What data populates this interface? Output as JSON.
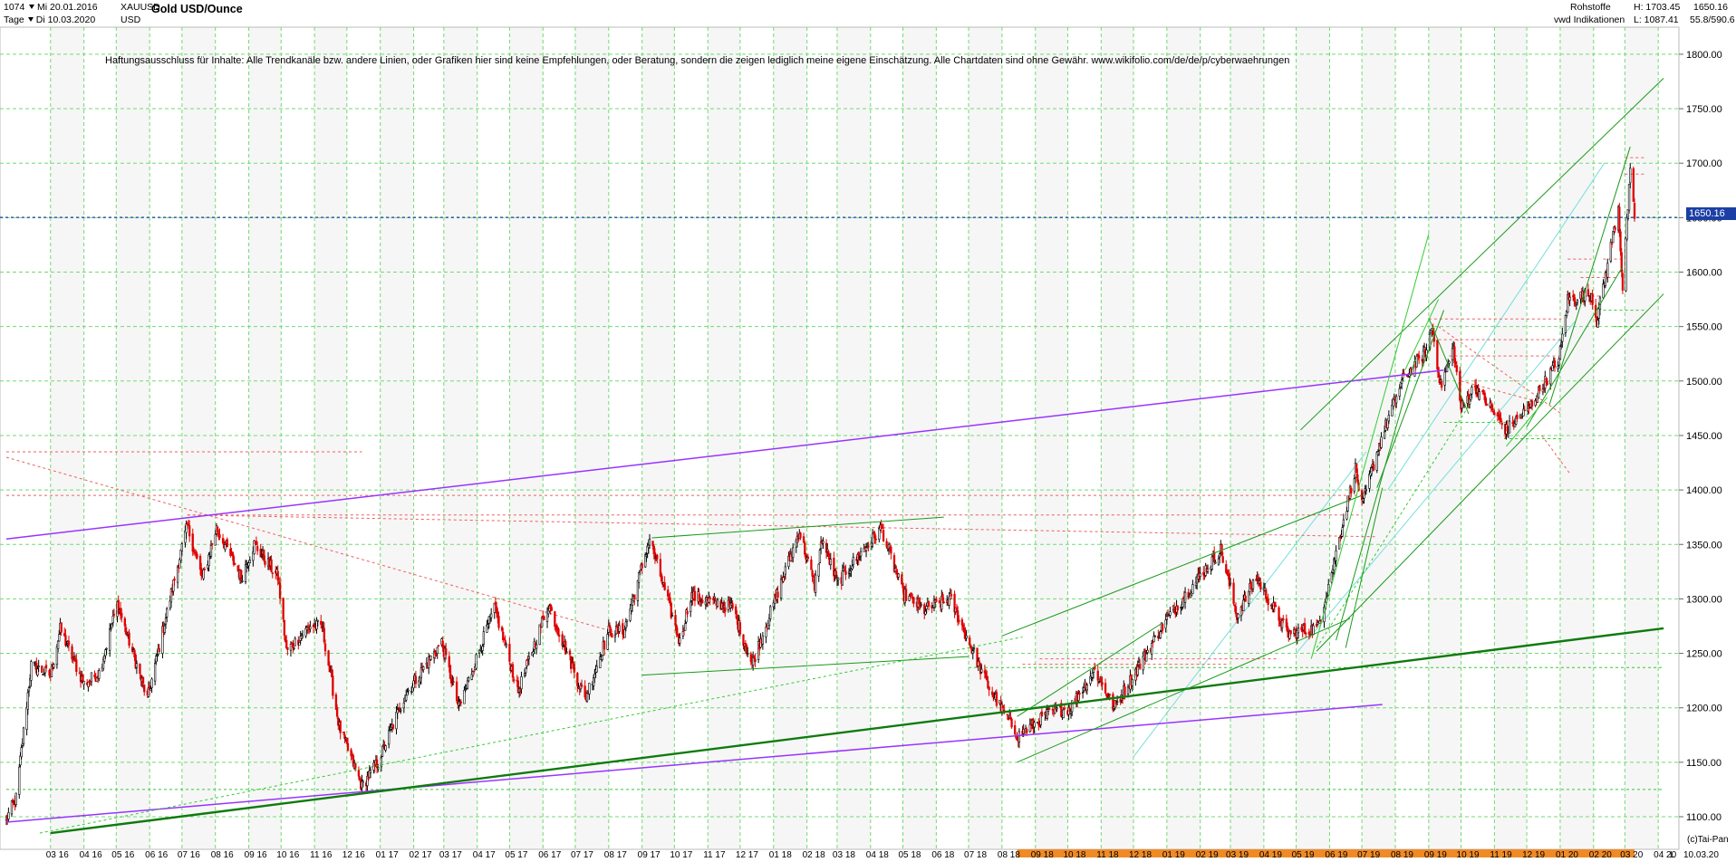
{
  "header": {
    "count": "1074",
    "start_label": "Mi 20.01.2016",
    "symbol": "XAUUSD",
    "currency": "USD",
    "interval": "Tage",
    "end_label": "Di 10.03.2020",
    "title": "Gold USD/Ounce",
    "category": "Rohstoffe",
    "source": "vwd Indikationen",
    "high_text": "H: 1703.45",
    "low_text": "L: 1087.41",
    "last_value": "1650.16",
    "last_change": "55.8/590.6"
  },
  "disclaimer": "Haftungsausschluss für Inhalte: Alle Trendkanäle bzw. andere Linien, oder Grafiken hier sind keine Empfehlungen, oder Beratung, sondern die zeigen lediglich meine eigene Einschätzung. Alle Chartdaten sind ohne Gewähr.  www.wikifolio.com/de/de/p/cyberwaehrungen",
  "copyright": "(c)Tai-Pan",
  "current_price_label": "1650.16",
  "colors": {
    "up_candle": "#000000",
    "down_candle": "#e00000",
    "grid": "#74d974",
    "current_line": "#1b3fa5",
    "axis_orange": "#f08a24",
    "purple_trend": "#9933ff",
    "green_trend": "#1a9a1a",
    "light_green": "#33cc33",
    "red_dotted": "#ee6060",
    "cyan": "#77dddd"
  },
  "chart_data": {
    "type": "candlestick",
    "title": "Gold USD/Ounce",
    "ylim": [
      1100,
      1800
    ],
    "y_ticks": [
      1100,
      1150,
      1200,
      1250,
      1300,
      1350,
      1400,
      1450,
      1500,
      1550,
      1600,
      1650,
      1700,
      1750,
      1800
    ],
    "y_tick_labels": [
      "1100.00",
      "1150.00",
      "1200.00",
      "1250.00",
      "1300.00",
      "1350.00",
      "1400.00",
      "1450.00",
      "1500.00",
      "1550.00",
      "1600.00",
      "1650.00",
      "1700.00",
      "1750.00",
      "1800.00"
    ],
    "x_tick_labels": [
      "03 16",
      "04 16",
      "05 16",
      "06 16",
      "07 16",
      "08 16",
      "09 16",
      "10 16",
      "11 16",
      "12 16",
      "01 17",
      "02 17",
      "03 17",
      "04 17",
      "05 17",
      "06 17",
      "07 17",
      "08 17",
      "09 17",
      "10 17",
      "11 17",
      "12 17",
      "01 18",
      "02 18",
      "03 18",
      "04 18",
      "05 18",
      "06 18",
      "07 18",
      "08 18",
      "09 18",
      "10 18",
      "11 18",
      "12 18",
      "01 19",
      "02 19",
      "03 19",
      "04 19",
      "05 19",
      "06 19",
      "07 19",
      "08 19",
      "09 19",
      "10 19",
      "11 19",
      "12 19",
      "01 20",
      "02 20",
      "03 20",
      "04 20"
    ],
    "x_end_label": "10.03.20",
    "x_axis_suffix": "L",
    "current_price": 1650.16,
    "high": 1703.45,
    "low": 1087.41,
    "monthly_anchors": [
      {
        "d": "2016-01-20",
        "c": 1098
      },
      {
        "d": "2016-01-29",
        "c": 1117
      },
      {
        "d": "2016-02-12",
        "c": 1239
      },
      {
        "d": "2016-03-01",
        "c": 1230
      },
      {
        "d": "2016-03-10",
        "c": 1272
      },
      {
        "d": "2016-04-01",
        "c": 1222
      },
      {
        "d": "2016-04-15",
        "c": 1232
      },
      {
        "d": "2016-05-02",
        "c": 1295
      },
      {
        "d": "2016-05-30",
        "c": 1208
      },
      {
        "d": "2016-06-24",
        "c": 1318
      },
      {
        "d": "2016-07-06",
        "c": 1367
      },
      {
        "d": "2016-07-20",
        "c": 1318
      },
      {
        "d": "2016-08-02",
        "c": 1365
      },
      {
        "d": "2016-08-25",
        "c": 1320
      },
      {
        "d": "2016-09-06",
        "c": 1350
      },
      {
        "d": "2016-09-28",
        "c": 1320
      },
      {
        "d": "2016-10-06",
        "c": 1252
      },
      {
        "d": "2016-10-28",
        "c": 1275
      },
      {
        "d": "2016-11-08",
        "c": 1275
      },
      {
        "d": "2016-11-24",
        "c": 1182
      },
      {
        "d": "2016-12-15",
        "c": 1128
      },
      {
        "d": "2016-12-30",
        "c": 1150
      },
      {
        "d": "2017-01-24",
        "c": 1212
      },
      {
        "d": "2017-02-27",
        "c": 1260
      },
      {
        "d": "2017-03-15",
        "c": 1200
      },
      {
        "d": "2017-04-17",
        "c": 1292
      },
      {
        "d": "2017-05-09",
        "c": 1215
      },
      {
        "d": "2017-06-06",
        "c": 1295
      },
      {
        "d": "2017-07-10",
        "c": 1208
      },
      {
        "d": "2017-08-01",
        "c": 1270
      },
      {
        "d": "2017-08-15",
        "c": 1270
      },
      {
        "d": "2017-09-08",
        "c": 1355
      },
      {
        "d": "2017-10-06",
        "c": 1260
      },
      {
        "d": "2017-10-16",
        "c": 1303
      },
      {
        "d": "2017-11-24",
        "c": 1292
      },
      {
        "d": "2017-12-12",
        "c": 1240
      },
      {
        "d": "2018-01-25",
        "c": 1362
      },
      {
        "d": "2018-02-08",
        "c": 1312
      },
      {
        "d": "2018-02-15",
        "c": 1355
      },
      {
        "d": "2018-03-01",
        "c": 1315
      },
      {
        "d": "2018-04-11",
        "c": 1365
      },
      {
        "d": "2018-05-01",
        "c": 1305
      },
      {
        "d": "2018-05-21",
        "c": 1290
      },
      {
        "d": "2018-06-14",
        "c": 1300
      },
      {
        "d": "2018-07-19",
        "c": 1220
      },
      {
        "d": "2018-08-16",
        "c": 1174
      },
      {
        "d": "2018-09-14",
        "c": 1195
      },
      {
        "d": "2018-10-03",
        "c": 1200
      },
      {
        "d": "2018-10-26",
        "c": 1235
      },
      {
        "d": "2018-11-13",
        "c": 1200
      },
      {
        "d": "2018-12-31",
        "c": 1280
      },
      {
        "d": "2019-01-31",
        "c": 1320
      },
      {
        "d": "2019-02-20",
        "c": 1345
      },
      {
        "d": "2019-03-07",
        "c": 1285
      },
      {
        "d": "2019-03-25",
        "c": 1320
      },
      {
        "d": "2019-04-23",
        "c": 1268
      },
      {
        "d": "2019-05-21",
        "c": 1273
      },
      {
        "d": "2019-06-03",
        "c": 1325
      },
      {
        "d": "2019-06-25",
        "c": 1420
      },
      {
        "d": "2019-07-01",
        "c": 1385
      },
      {
        "d": "2019-07-18",
        "c": 1445
      },
      {
        "d": "2019-08-07",
        "c": 1500
      },
      {
        "d": "2019-08-30",
        "c": 1528
      },
      {
        "d": "2019-09-04",
        "c": 1550
      },
      {
        "d": "2019-09-12",
        "c": 1495
      },
      {
        "d": "2019-09-24",
        "c": 1530
      },
      {
        "d": "2019-10-01",
        "c": 1475
      },
      {
        "d": "2019-10-14",
        "c": 1495
      },
      {
        "d": "2019-11-12",
        "c": 1455
      },
      {
        "d": "2019-12-03",
        "c": 1475
      },
      {
        "d": "2019-12-31",
        "c": 1520
      },
      {
        "d": "2020-01-08",
        "c": 1575
      },
      {
        "d": "2020-01-30",
        "c": 1580
      },
      {
        "d": "2020-02-04",
        "c": 1555
      },
      {
        "d": "2020-02-24",
        "c": 1660
      },
      {
        "d": "2020-02-28",
        "c": 1585
      },
      {
        "d": "2020-03-06",
        "c": 1690
      },
      {
        "d": "2020-03-10",
        "c": 1650
      }
    ],
    "trendlines": [
      {
        "kind": "purple",
        "from": [
          "2016-01-20",
          1355
        ],
        "to": [
          "2019-09-15",
          1510
        ]
      },
      {
        "kind": "purple",
        "from": [
          "2016-01-20",
          1095
        ],
        "to": [
          "2019-07-20",
          1203
        ]
      },
      {
        "kind": "green_thick",
        "from": [
          "2016-03-01",
          1085
        ],
        "to": [
          "2020-04-06",
          1273
        ]
      },
      {
        "kind": "green",
        "from": [
          "2018-08-15",
          1150
        ],
        "to": [
          "2019-06-20",
          1282
        ]
      },
      {
        "kind": "green",
        "from": [
          "2018-08-15",
          1192
        ],
        "to": [
          "2018-12-28",
          1278
        ]
      },
      {
        "kind": "green",
        "from": [
          "2018-08-01",
          1266
        ],
        "to": [
          "2019-07-01",
          1395
        ]
      },
      {
        "kind": "green",
        "from": [
          "2017-09-10",
          1356
        ],
        "to": [
          "2018-06-08",
          1375
        ]
      },
      {
        "kind": "green",
        "from": [
          "2017-09-01",
          1230
        ],
        "to": [
          "2018-07-01",
          1247
        ]
      },
      {
        "kind": "green",
        "from": [
          "2019-05-05",
          1455
        ],
        "to": [
          "2020-04-06",
          1778
        ]
      },
      {
        "kind": "green",
        "from": [
          "2019-05-20",
          1252
        ],
        "to": [
          "2020-04-06",
          1580
        ]
      },
      {
        "kind": "green",
        "from": [
          "2019-07-15",
          1402
        ],
        "to": [
          "2019-09-15",
          1565
        ]
      },
      {
        "kind": "green",
        "from": [
          "2019-09-01",
          1558
        ],
        "to": [
          "2019-10-08",
          1470
        ]
      },
      {
        "kind": "green",
        "from": [
          "2019-06-07",
          1262
        ],
        "to": [
          "2019-08-20",
          1522
        ]
      },
      {
        "kind": "green",
        "from": [
          "2019-06-16",
          1255
        ],
        "to": [
          "2019-07-20",
          1402
        ]
      },
      {
        "kind": "green",
        "from": [
          "2019-12-01",
          1458
        ],
        "to": [
          "2020-02-28",
          1605
        ]
      },
      {
        "kind": "green",
        "from": [
          "2019-12-22",
          1478
        ],
        "to": [
          "2020-03-06",
          1715
        ]
      },
      {
        "kind": "light_green",
        "from": [
          "2019-05-15",
          1245
        ],
        "to": [
          "2019-09-01",
          1635
        ]
      },
      {
        "kind": "light_green",
        "from": [
          "2019-08-10",
          1510
        ],
        "to": [
          "2019-09-10",
          1575
        ]
      },
      {
        "kind": "light_green",
        "from": [
          "2019-11-12",
          1440
        ],
        "to": [
          "2019-12-20",
          1485
        ]
      },
      {
        "kind": "light_green_dotted",
        "from": [
          "2016-02-20",
          1085
        ],
        "to": [
          "2018-08-20",
          1265
        ]
      },
      {
        "kind": "light_green_dotted",
        "from": [
          "2019-05-20",
          1255
        ],
        "to": [
          "2019-10-10",
          1480
        ]
      },
      {
        "kind": "cyan",
        "from": [
          "2018-12-01",
          1155
        ],
        "to": [
          "2019-07-05",
          1435
        ]
      },
      {
        "kind": "cyan",
        "from": [
          "2019-07-25",
          1400
        ],
        "to": [
          "2020-02-11",
          1700
        ]
      },
      {
        "kind": "cyan",
        "from": [
          "2019-05-01",
          1250
        ],
        "to": [
          "2020-01-15",
          1555
        ]
      },
      {
        "kind": "red_dotted",
        "from": [
          "2016-01-20",
          1435
        ],
        "to": [
          "2016-12-15",
          1435
        ]
      },
      {
        "kind": "red_dotted",
        "from": [
          "2016-01-20",
          1395
        ],
        "to": [
          "2019-07-01",
          1395
        ]
      },
      {
        "kind": "red_dotted",
        "from": [
          "2016-07-06",
          1377
        ],
        "to": [
          "2019-07-01",
          1377
        ]
      },
      {
        "kind": "red_dotted",
        "from": [
          "2016-07-06",
          1377
        ],
        "to": [
          "2019-07-15",
          1357
        ]
      },
      {
        "kind": "red_dotted",
        "from": [
          "2016-01-20",
          1430
        ],
        "to": [
          "2017-08-05",
          1270
        ]
      },
      {
        "kind": "red_dotted",
        "from": [
          "2018-08-20",
          1240
        ],
        "to": [
          "2019-02-28",
          1240
        ]
      },
      {
        "kind": "red_dotted",
        "from": [
          "2018-09-05",
          1245
        ],
        "to": [
          "2019-04-15",
          1245
        ]
      },
      {
        "kind": "red_dotted",
        "from": [
          "2019-09-01",
          1557
        ],
        "to": [
          "2020-01-02",
          1557
        ]
      },
      {
        "kind": "red_dotted",
        "from": [
          "2019-09-05",
          1538
        ],
        "to": [
          "2020-01-02",
          1538
        ]
      },
      {
        "kind": "red_dotted",
        "from": [
          "2019-09-20",
          1523
        ],
        "to": [
          "2020-01-02",
          1523
        ]
      },
      {
        "kind": "red_dotted",
        "from": [
          "2019-10-01",
          1500
        ],
        "to": [
          "2019-12-15",
          1480
        ]
      },
      {
        "kind": "red_dotted",
        "from": [
          "2019-09-10",
          1550
        ],
        "to": [
          "2020-01-02",
          1470
        ]
      },
      {
        "kind": "red_dotted",
        "from": [
          "2019-12-15",
          1450
        ],
        "to": [
          "2020-01-10",
          1415
        ]
      },
      {
        "kind": "red_dotted",
        "from": [
          "2020-01-08",
          1612
        ],
        "to": [
          "2020-01-30",
          1612
        ]
      },
      {
        "kind": "red_dotted",
        "from": [
          "2020-01-20",
          1595
        ],
        "to": [
          "2020-02-24",
          1595
        ]
      },
      {
        "kind": "red_dotted",
        "from": [
          "2020-01-20",
          1578
        ],
        "to": [
          "2020-02-10",
          1578
        ]
      },
      {
        "kind": "red_dotted",
        "from": [
          "2020-02-10",
          1612
        ],
        "to": [
          "2020-03-01",
          1612
        ]
      },
      {
        "kind": "red_dotted",
        "from": [
          "2020-03-01",
          1705
        ],
        "to": [
          "2020-03-20",
          1705
        ]
      },
      {
        "kind": "red_dotted",
        "from": [
          "2020-03-01",
          1690
        ],
        "to": [
          "2020-03-20",
          1690
        ]
      },
      {
        "kind": "green_dotted",
        "from": [
          "2016-01-20",
          1125
        ],
        "to": [
          "2020-04-06",
          1125
        ]
      },
      {
        "kind": "green_dotted",
        "from": [
          "2018-07-01",
          1237
        ],
        "to": [
          "2020-04-06",
          1237
        ]
      },
      {
        "kind": "green_dotted",
        "from": [
          "2019-09-15",
          1462
        ],
        "to": [
          "2019-11-15",
          1462
        ]
      },
      {
        "kind": "green_dotted",
        "from": [
          "2019-11-10",
          1447
        ],
        "to": [
          "2020-01-02",
          1447
        ]
      },
      {
        "kind": "green_dotted",
        "from": [
          "2020-02-10",
          1565
        ],
        "to": [
          "2020-03-20",
          1565
        ]
      },
      {
        "kind": "green_dotted",
        "from": [
          "2020-02-20",
          1550
        ],
        "to": [
          "2020-03-15",
          1550
        ]
      }
    ]
  }
}
